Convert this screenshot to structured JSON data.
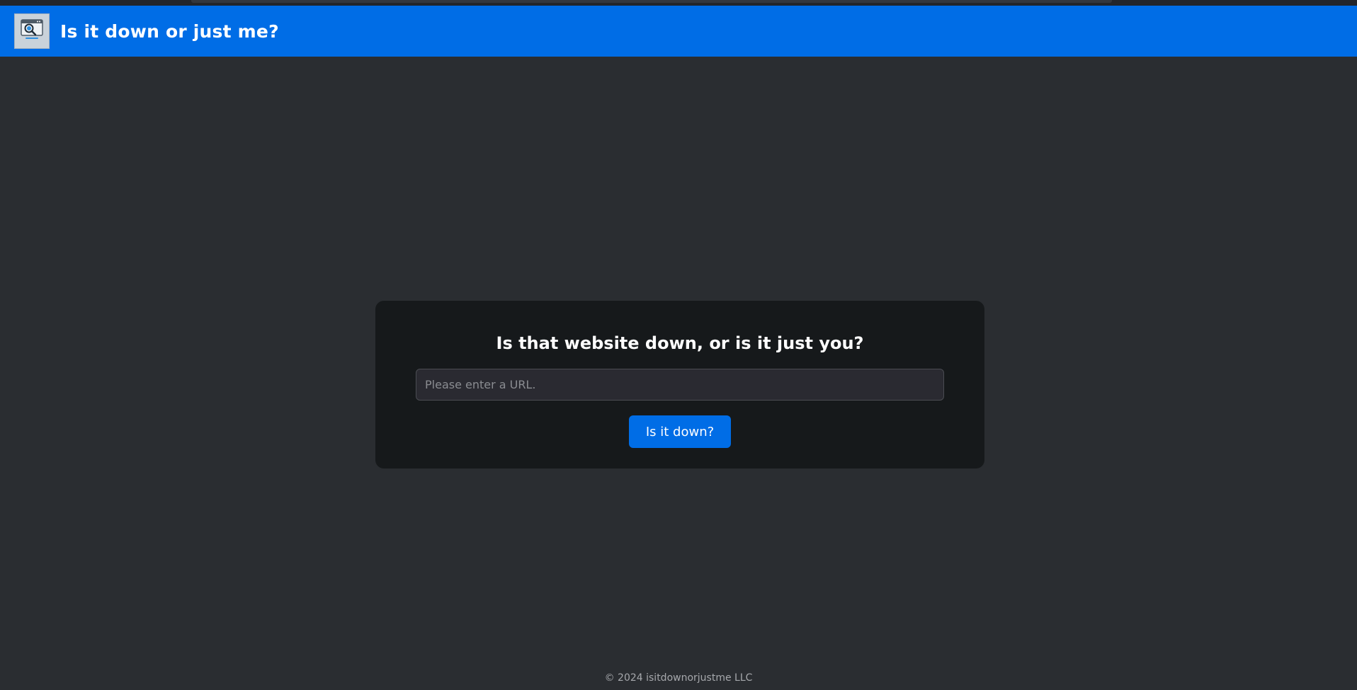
{
  "header": {
    "title": "Is it down or just me?",
    "logo_icon": "magnifier-browser-icon",
    "background_color": "#006de6"
  },
  "main": {
    "heading": "Is that website down, or is it just you?",
    "url_input": {
      "value": "",
      "placeholder": "Please enter a URL."
    },
    "submit_label": "Is it down?"
  },
  "footer": {
    "copyright": "© 2024 isitdownorjustme LLC"
  },
  "colors": {
    "page_background": "#2a2d31",
    "card_background": "#16191b",
    "accent": "#006de6"
  }
}
